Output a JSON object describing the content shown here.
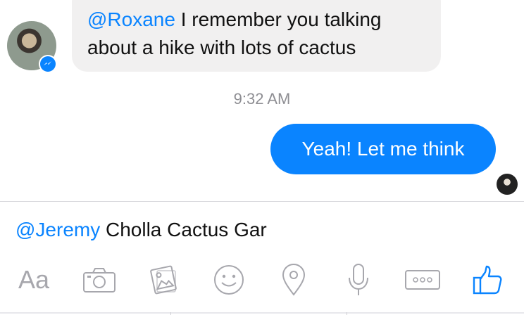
{
  "incoming_message": {
    "mention": "@Roxane",
    "text": " I remember you talking about a hike with lots of cactus"
  },
  "timestamp": "9:32 AM",
  "outgoing_message": {
    "text": "Yeah! Let me think"
  },
  "composer": {
    "mention": "@Jeremy",
    "text": " Cholla Cactus Gar"
  },
  "toolbar": {
    "aa_label": "Aa",
    "icons": [
      "camera-icon",
      "photo-gallery-icon",
      "emoji-icon",
      "location-icon",
      "microphone-icon",
      "more-icon",
      "like-icon"
    ]
  },
  "colors": {
    "accent": "#0a84ff",
    "incoming_bubble": "#f1f0f0",
    "icon_gray": "#a7a7ad",
    "timestamp_gray": "#8e8e93"
  }
}
